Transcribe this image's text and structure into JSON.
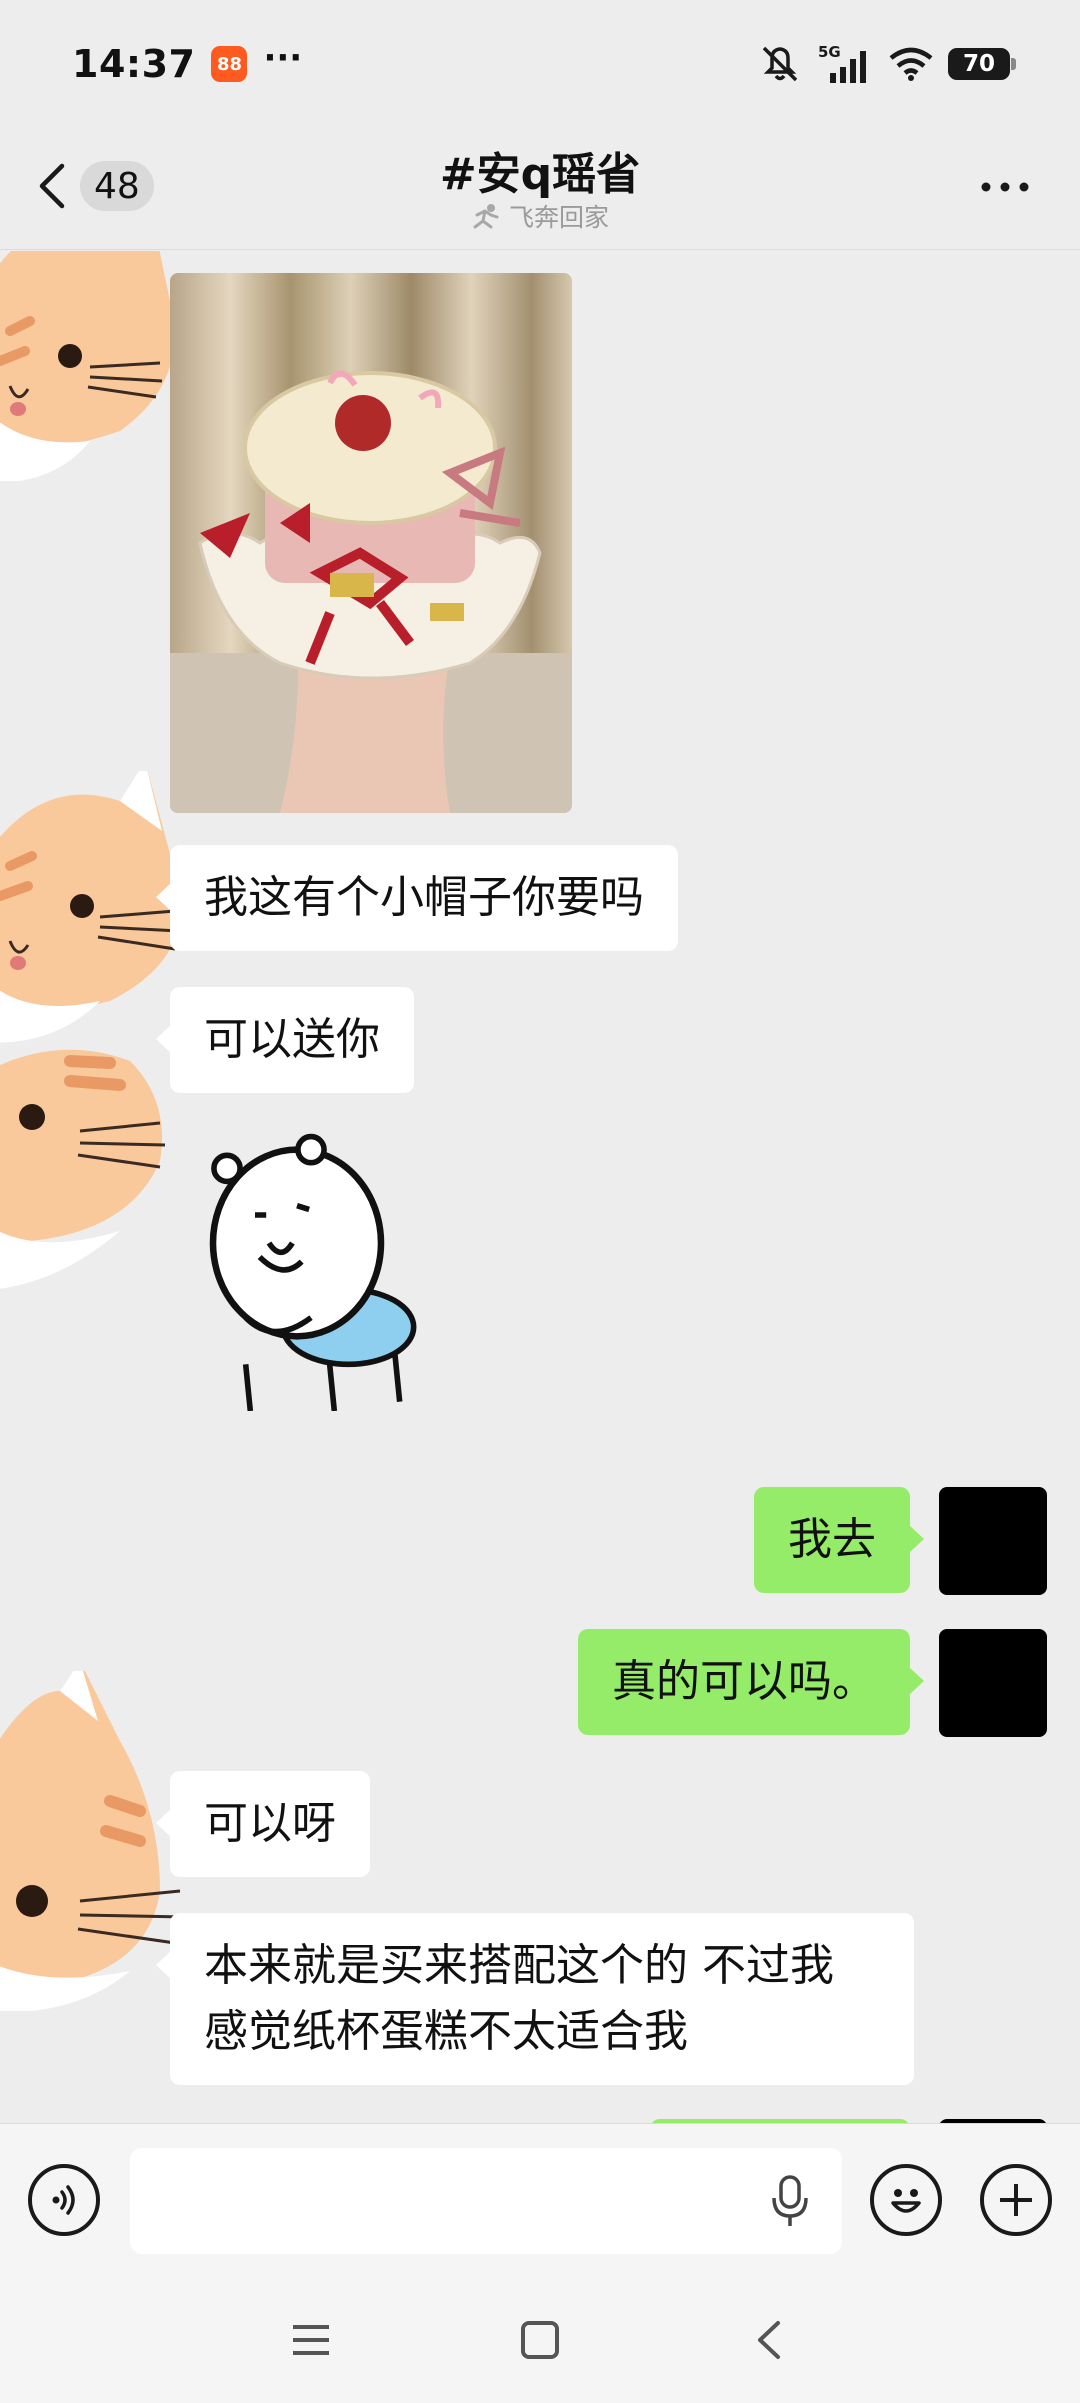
{
  "status_bar": {
    "time": "14:37",
    "app_badge": "88",
    "more": "···",
    "network": "5G",
    "battery": "70"
  },
  "header": {
    "unread_count": "48",
    "title": "#安q瑶省",
    "subtitle": "飞奔回家"
  },
  "messages": [
    {
      "side": "left",
      "type": "image",
      "description": "crocheted cake hat"
    },
    {
      "side": "left",
      "type": "text",
      "text": "我这有个小帽子你要吗"
    },
    {
      "side": "left",
      "type": "text",
      "text": "可以送你"
    },
    {
      "side": "left",
      "type": "sticker",
      "description": "hamster-sticker"
    },
    {
      "side": "right",
      "type": "text",
      "text": "我去"
    },
    {
      "side": "right",
      "type": "text",
      "text": "真的可以吗。"
    },
    {
      "side": "left",
      "type": "text",
      "text": "可以呀"
    },
    {
      "side": "left",
      "type": "text",
      "lines": [
        "本来就是买来搭配这个的 不过我",
        "感觉纸杯蛋糕不太适合我"
      ]
    }
  ],
  "input": {
    "placeholder": ""
  },
  "colors": {
    "background": "#ededed",
    "self_bubble": "#95ec69",
    "other_bubble": "#ffffff",
    "cat_orange": "#f9c89b"
  }
}
